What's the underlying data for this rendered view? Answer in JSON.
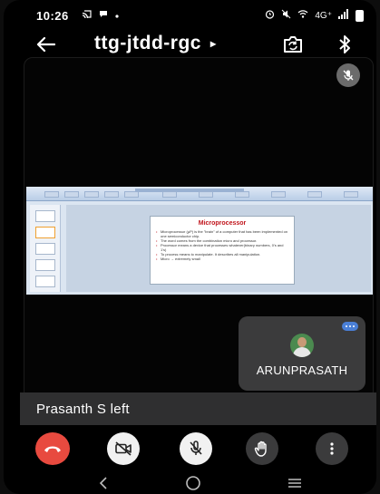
{
  "status_bar": {
    "time": "10:26",
    "left_icons": [
      "cast-icon",
      "chat-icon",
      "dot-icon"
    ],
    "right_icons": [
      "alarm-icon",
      "mute-icon",
      "wifi-call-icon",
      "signal-icon",
      "battery-icon"
    ],
    "network": "4G⁺"
  },
  "top_bar": {
    "title": "ttg-jtdd-rgc",
    "title_caret": "▸"
  },
  "stage": {
    "shared_slide": {
      "title": "Microprocessor",
      "bullets": [
        "Microprocessor (µP) is the \"brain\" of a computer that has been implemented on one semiconductor chip.",
        "The word comes from the combination micro and processor.",
        "Processor means a device that processes whatever(binary numbers, 0's and 1's)",
        "To process means to manipulate. It describes all manipulation.",
        "Micro → extremely small"
      ]
    },
    "self_tile": {
      "name": "ARUNPRASATH"
    }
  },
  "notice": {
    "text": "Prasanth S left"
  },
  "colors": {
    "end_call": "#e84a3f",
    "tile_bg": "#3b3b3c",
    "accent": "#4a7fd6"
  }
}
